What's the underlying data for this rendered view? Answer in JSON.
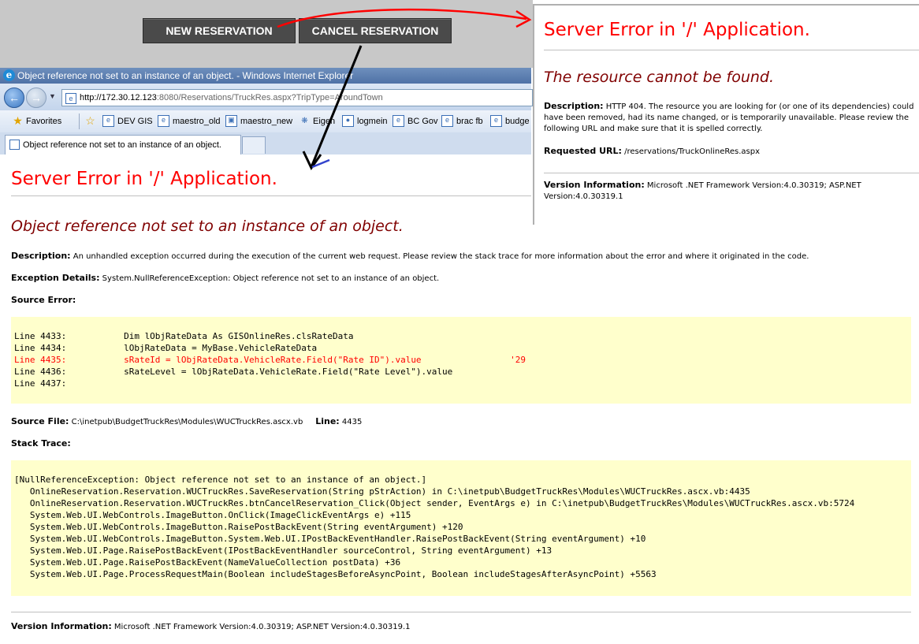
{
  "buttons": {
    "new_reservation": "NEW RESERVATION",
    "cancel_reservation": "CANCEL RESERVATION"
  },
  "browser": {
    "title": "Object reference not set to an instance of an object. - Windows Internet Explorer",
    "address_host": "http://172.30.12.123",
    "address_rest": ":8080/Reservations/TruckRes.aspx?TripType=AroundTown",
    "favorites_label": "Favorites",
    "favorites": [
      "DEV GIS",
      "maestro_old",
      "maestro_new",
      "Eigen",
      "logmein",
      "BC Gov",
      "brac fb",
      "budge"
    ],
    "tab_label": "Object reference not set to an instance of an object."
  },
  "main": {
    "heading": "Server Error in '/' Application.",
    "error_title": "Object reference not set to an instance of an object.",
    "description_label": "Description:",
    "description_text": "An unhandled exception occurred during the execution of the current web request. Please review the stack trace for more information about the error and where it originated in the code.",
    "exception_label": "Exception Details:",
    "exception_text": "System.NullReferenceException: Object reference not set to an instance of an object.",
    "source_error_label": "Source Error:",
    "source_lines": [
      "Line 4433:           Dim lObjRateData As GISOnlineRes.clsRateData",
      "Line 4434:           lObjRateData = MyBase.VehicleRateData",
      "Line 4435:           sRateId = lObjRateData.VehicleRate.Field(\"Rate ID\").value                 '29",
      "Line 4436:           sRateLevel = lObjRateData.VehicleRate.Field(\"Rate Level\").value",
      "Line 4437:"
    ],
    "source_file_label": "Source File:",
    "source_file": "C:\\inetpub\\BudgetTruckRes\\Modules\\WUCTruckRes.ascx.vb",
    "line_label": "Line:",
    "line_number": "4435",
    "stack_trace_label": "Stack Trace:",
    "stack_lines": [
      "[NullReferenceException: Object reference not set to an instance of an object.]",
      "   OnlineReservation.Reservation.WUCTruckRes.SaveReservation(String pStrAction) in C:\\inetpub\\BudgetTruckRes\\Modules\\WUCTruckRes.ascx.vb:4435",
      "   OnlineReservation.Reservation.WUCTruckRes.btnCancelReservation_Click(Object sender, EventArgs e) in C:\\inetpub\\BudgetTruckRes\\Modules\\WUCTruckRes.ascx.vb:5724",
      "   System.Web.UI.WebControls.ImageButton.OnClick(ImageClickEventArgs e) +115",
      "   System.Web.UI.WebControls.ImageButton.RaisePostBackEvent(String eventArgument) +120",
      "   System.Web.UI.WebControls.ImageButton.System.Web.UI.IPostBackEventHandler.RaisePostBackEvent(String eventArgument) +10",
      "   System.Web.UI.Page.RaisePostBackEvent(IPostBackEventHandler sourceControl, String eventArgument) +13",
      "   System.Web.UI.Page.RaisePostBackEvent(NameValueCollection postData) +36",
      "   System.Web.UI.Page.ProcessRequestMain(Boolean includeStagesBeforeAsyncPoint, Boolean includeStagesAfterAsyncPoint) +5563"
    ],
    "version_label": "Version Information:",
    "version_text": "Microsoft .NET Framework Version:4.0.30319; ASP.NET Version:4.0.30319.1"
  },
  "popup": {
    "heading": "Server Error in '/' Application.",
    "error_title": "The resource cannot be found.",
    "description_label": "Description:",
    "description_text": "HTTP 404. The resource you are looking for (or one of its dependencies) could have been removed, had its name changed, or is temporarily unavailable.  Please review the following URL and make sure that it is spelled correctly.",
    "requested_label": "Requested URL:",
    "requested_url": "/reservations/TruckOnlineRes.aspx",
    "version_label": "Version Information:",
    "version_text": "Microsoft .NET Framework Version:4.0.30319; ASP.NET Version:4.0.30319.1"
  },
  "colors": {
    "error_red": "#ff0000",
    "error_maroon": "#800000",
    "code_bg": "#ffffcc",
    "arrow_red": "#ff0000",
    "arrow_black": "#000000",
    "arrow_blue": "#3344cc"
  },
  "icons": [
    "back-arrow-icon",
    "forward-arrow-icon",
    "ie-logo-icon",
    "page-icon",
    "favorites-star-icon"
  ]
}
